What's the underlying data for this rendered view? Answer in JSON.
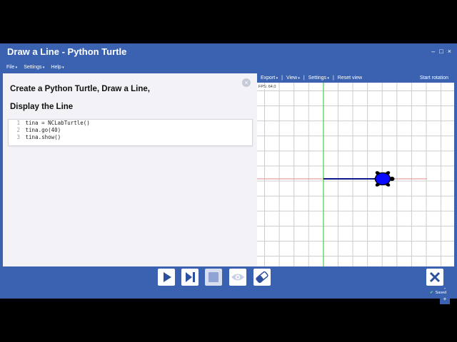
{
  "window": {
    "title": "Draw a Line - Python Turtle",
    "controls": [
      "–",
      "□",
      "×"
    ]
  },
  "menu": [
    "File",
    "Settings",
    "Help"
  ],
  "instructions": {
    "line1": "Create a Python Turtle, Draw a Line,",
    "line2": "Display the Line",
    "close_glyph": "×"
  },
  "code": {
    "lines": [
      {
        "num": "1",
        "text": "tina = NCLabTurtle()"
      },
      {
        "num": "2",
        "text": "tina.go(40)"
      },
      {
        "num": "3",
        "text": "tina.show()"
      }
    ]
  },
  "canvas_toolbar": {
    "export": "Export",
    "view": "View",
    "settings": "Settings",
    "reset": "Reset view",
    "rotation": "Start rotation",
    "separator": "|"
  },
  "canvas": {
    "fps": "FPS: 64.0",
    "turtle_color": "#0a0aff",
    "line_color": "#0f1a8a",
    "x_axis_color": "#e08a8a",
    "y_axis_color": "#4ad04a"
  },
  "zoom": {
    "minus": "-",
    "plus": "+"
  },
  "controls": {
    "run": "play-icon",
    "step": "step-icon",
    "stop": "stop-icon",
    "show": "eye-icon",
    "erase": "eraser-icon",
    "close": "close-icon"
  },
  "status": {
    "check": "✔",
    "saved": "Saved"
  },
  "colors": {
    "app_bg": "#3a62b0",
    "panel_bg": "#f3f3f7"
  }
}
